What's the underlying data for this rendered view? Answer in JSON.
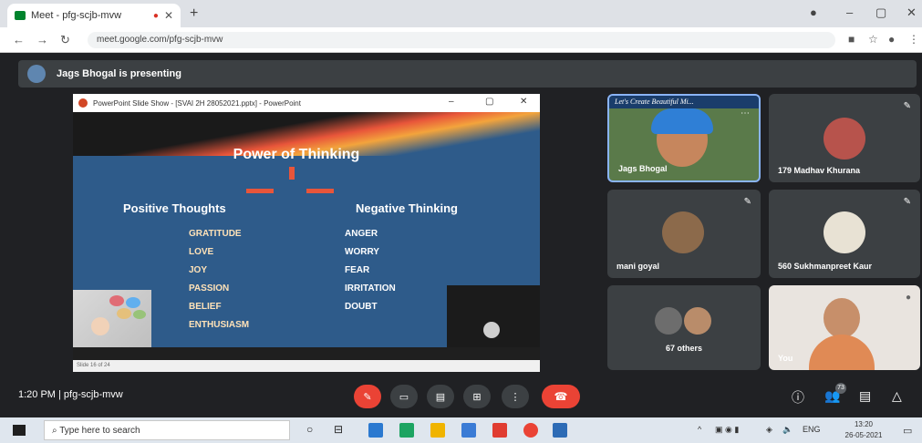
{
  "browser": {
    "tab_title": "Meet - pfg-scjb-mvw",
    "new_tab": "+",
    "url": "meet.google.com/pfg-scjb-mvw"
  },
  "meet": {
    "presenting_text": "Jags Bhogal is presenting"
  },
  "ppt": {
    "window_title": "PowerPoint Slide Show - [SVAI 2H 28052021.pptx] - PowerPoint",
    "slide_title": "Power of Thinking",
    "positive_heading": "Positive Thoughts",
    "negative_heading": "Negative Thinking",
    "positive_words": [
      "GRATITUDE",
      "LOVE",
      "JOY",
      "PASSION",
      "BELIEF",
      "ENTHUSIASM"
    ],
    "negative_words": [
      "ANGER",
      "WORRY",
      "FEAR",
      "IRRITATION",
      "DOUBT"
    ],
    "status_text": "Slide 16 of 24"
  },
  "participants": [
    {
      "name": "Jags Bhogal",
      "banner": "Let's Create Beautiful Mi..."
    },
    {
      "name": "179 Madhav Khurana"
    },
    {
      "name": "mani goyal"
    },
    {
      "name": "560 Sukhmanpreet Kaur"
    },
    {
      "name": "67 others"
    },
    {
      "name": "You"
    }
  ],
  "toolbar": {
    "time_meeting": "1:20 PM  |  pfg-scjb-mvw",
    "participant_count": "73"
  },
  "taskbar": {
    "search_placeholder": "Type here to search",
    "tray_lang": "ENG",
    "time": "13:20",
    "date": "26-05-2021"
  },
  "colors": {
    "end_call": "#ea4335",
    "slide_bg": "#2e5b8a",
    "accent_orange": "#e8553a"
  }
}
